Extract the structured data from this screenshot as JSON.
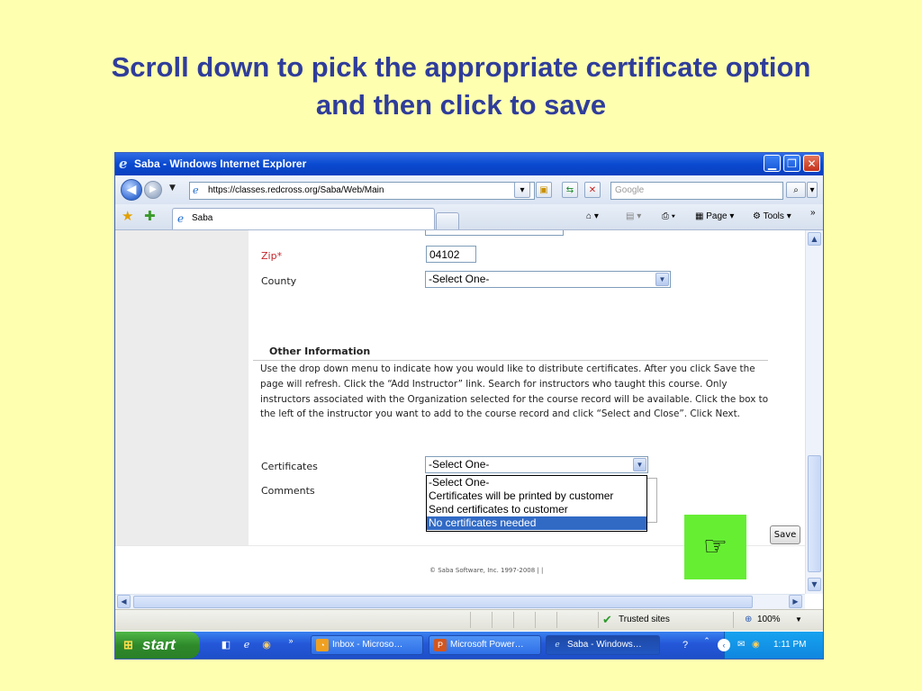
{
  "slide": {
    "title_line1": "Scroll down to pick the appropriate certificate option",
    "title_line2": "and then click to save",
    "pointer_glyph": "☞",
    "pointer_color": "#66ee33"
  },
  "window": {
    "title": "Saba - Windows Internet Explorer",
    "minimize_glyph": "▁",
    "restore_glyph": "❐",
    "close_glyph": "✕"
  },
  "addressbar": {
    "url": "https://classes.redcross.org/Saba/Web/Main",
    "search_placeholder": "Google"
  },
  "tabs": {
    "active_tab": "Saba",
    "commands": {
      "page_label": "Page",
      "tools_label": "Tools",
      "overflow": "»"
    }
  },
  "form": {
    "zip_label": "Zip*",
    "zip_value": "04102",
    "county_label": "County",
    "county_value": "-Select One-",
    "section_title": "Other Information",
    "instructions": "Use the drop down menu to indicate how you would like to distribute certificates. After you click Save the page will refresh. Click the “Add Instructor” link. Search for instructors who taught this course. Only instructors associated with the Organization selected for the course record will be available. Click the box to the left of the instructor you want to add to the course record and click “Select and Close”. Click Next.",
    "certificates_label": "Certificates",
    "certificates_value": "-Select One-",
    "certificate_options": [
      "-Select One-",
      "Certificates will be printed by customer",
      "Send certificates to customer",
      "No certificates needed"
    ],
    "selected_option_index": 3,
    "comments_label": "Comments",
    "save_label": "Save",
    "footer": "© Saba Software, Inc. 1997-2008 |   |"
  },
  "statusbar": {
    "zone": "Trusted sites",
    "zoom": "100%"
  },
  "taskbar": {
    "start_label": "start",
    "items": [
      {
        "label": "Inbox - Microso…",
        "active": false,
        "icon": "outlook-icon"
      },
      {
        "label": "Microsoft Power…",
        "active": false,
        "icon": "powerpoint-icon"
      },
      {
        "label": "Saba - Windows…",
        "active": true,
        "icon": "ie-icon"
      }
    ],
    "clock": "1:11 PM"
  },
  "colors": {
    "title_text": "#2f3d9a",
    "slide_background": "#ffffb0",
    "selection_highlight": "#316ac5",
    "required_label": "#c2272d"
  }
}
